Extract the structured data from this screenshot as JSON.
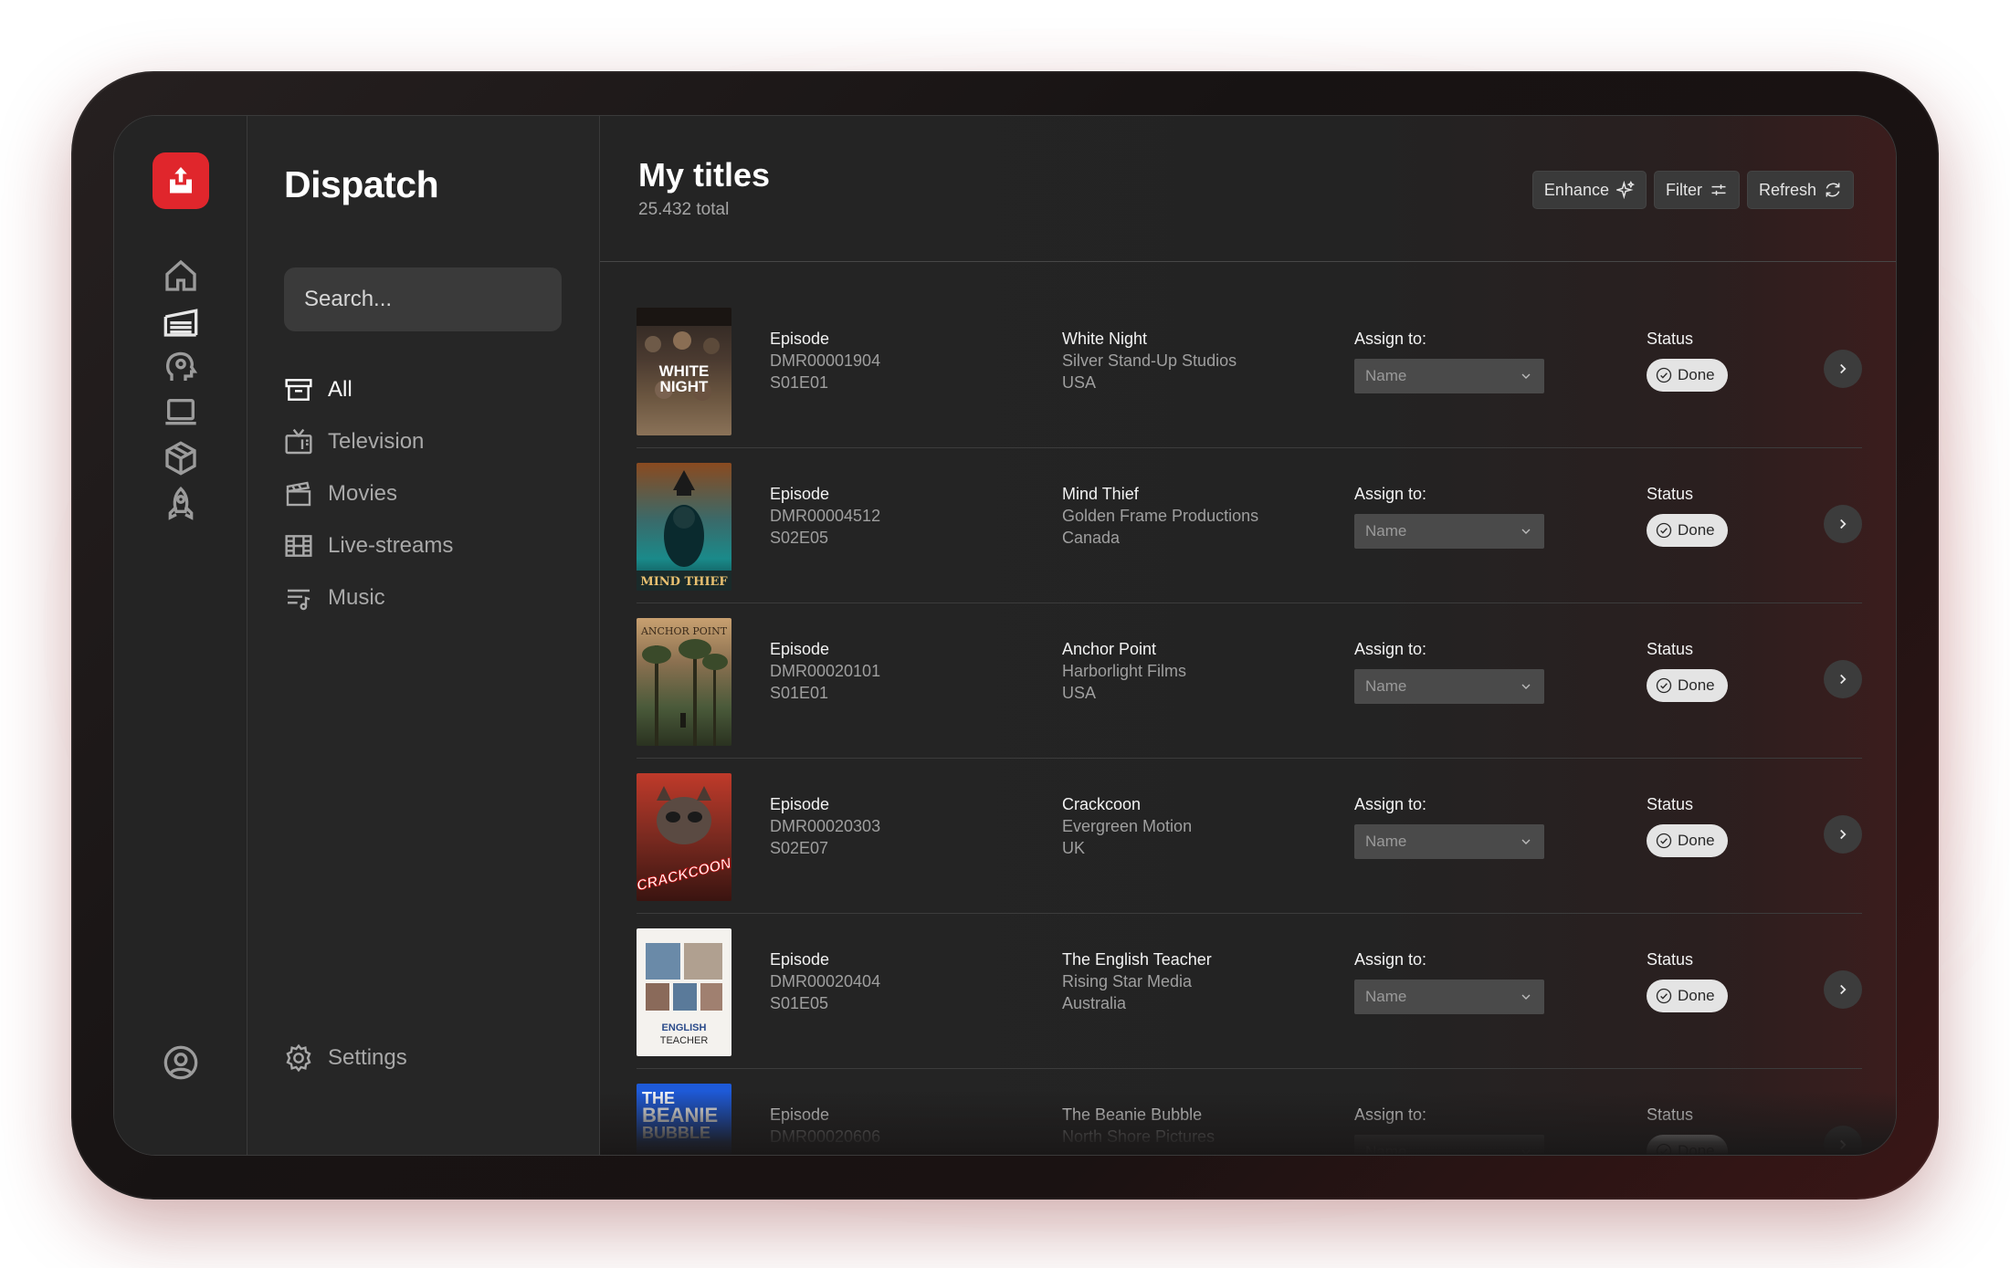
{
  "app": {
    "name": "Dispatch"
  },
  "search": {
    "placeholder": "Search..."
  },
  "nav": {
    "items": [
      {
        "label": "All",
        "icon": "archive-icon",
        "active": true
      },
      {
        "label": "Television",
        "icon": "tv-icon"
      },
      {
        "label": "Movies",
        "icon": "clapperboard-icon"
      },
      {
        "label": "Live-streams",
        "icon": "film-grid-icon"
      },
      {
        "label": "Music",
        "icon": "music-list-icon"
      }
    ],
    "settings_label": "Settings"
  },
  "rail": {
    "icons": [
      "home-icon",
      "warehouse-icon",
      "head-gear-icon",
      "laptop-icon",
      "box-icon",
      "rocket-icon",
      "user-circle-icon"
    ]
  },
  "header": {
    "title": "My titles",
    "subtitle": "25.432 total",
    "enhance_label": "Enhance",
    "filter_label": "Filter",
    "refresh_label": "Refresh"
  },
  "columns": {
    "assign_label": "Assign to:",
    "status_label": "Status",
    "assign_placeholder": "Name"
  },
  "titles": [
    {
      "type": "Episode",
      "id": "DMR00001904",
      "episode": "S01E01",
      "name": "White Night",
      "studio": "Silver Stand-Up Studios",
      "country": "USA",
      "status": "Done",
      "poster_text": "WHITE NIGHT"
    },
    {
      "type": "Episode",
      "id": "DMR00004512",
      "episode": "S02E05",
      "name": "Mind Thief",
      "studio": "Golden Frame Productions",
      "country": "Canada",
      "status": "Done",
      "poster_text": "MIND THIEF"
    },
    {
      "type": "Episode",
      "id": "DMR00020101",
      "episode": "S01E01",
      "name": "Anchor Point",
      "studio": "Harborlight Films",
      "country": "USA",
      "status": "Done",
      "poster_text": "ANCHOR POINT"
    },
    {
      "type": "Episode",
      "id": "DMR00020303",
      "episode": "S02E07",
      "name": "Crackcoon",
      "studio": "Evergreen Motion",
      "country": "UK",
      "status": "Done",
      "poster_text": "CRACKCOON"
    },
    {
      "type": "Episode",
      "id": "DMR00020404",
      "episode": "S01E05",
      "name": "The English Teacher",
      "studio": "Rising Star Media",
      "country": "Australia",
      "status": "Done",
      "poster_text": "THE ENGLISH TEACHER"
    },
    {
      "type": "Episode",
      "id": "DMR00020606",
      "episode": "",
      "name": "The Beanie Bubble",
      "studio": "North Shore Pictures",
      "country": "",
      "status": "Done",
      "poster_text": "THE BEANIE BUBBLE"
    }
  ]
}
